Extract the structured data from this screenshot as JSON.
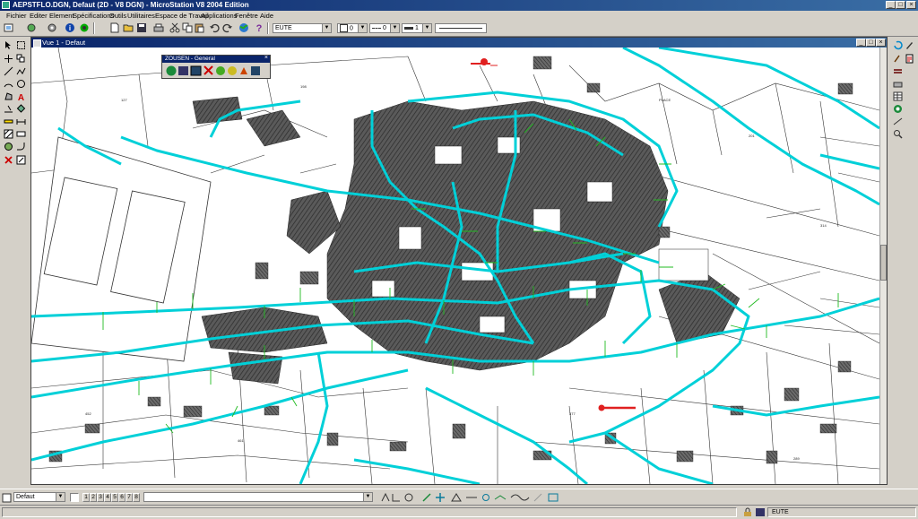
{
  "window": {
    "title": "AEPSTFLO.DGN, Defaut (2D - V8 DGN) - MicroStation V8 2004 Edition",
    "min_label": "_",
    "max_label": "□",
    "close_label": "×"
  },
  "menu": [
    "Fichier",
    "Editer",
    "Element",
    "Spécifications",
    "Outils",
    "Utilitaires",
    "Espace de Travail",
    "Applications",
    "Fenêtre",
    "Aide"
  ],
  "toolbar": {
    "level_combo": "EUTE",
    "color_value": "0",
    "style_value": "0",
    "weight_value": "1"
  },
  "view": {
    "title": "Vue 1 - Defaut"
  },
  "float_palette": {
    "title": "ZOUSEN - General"
  },
  "bottom": {
    "model_combo": "Defaut",
    "view_buttons": [
      "1",
      "2",
      "3",
      "4",
      "5",
      "6",
      "7",
      "8"
    ]
  },
  "status": {
    "level_text": "EUTE"
  },
  "icons": {
    "toolbar": [
      "new-file-icon",
      "open-icon",
      "save-icon",
      "print-icon",
      "cut-icon",
      "copy-icon",
      "paste-icon",
      "undo-icon",
      "redo-icon",
      "globe-icon",
      "help-icon"
    ],
    "left_palette": [
      "select-icon",
      "fence-icon",
      "line-icon",
      "circle-icon",
      "text-icon",
      "cell-icon",
      "measure-icon",
      "delete-icon"
    ]
  },
  "colors": {
    "network": "#00d0d8",
    "branch": "#22bb22",
    "marker": "#e02020",
    "building": "#4a4a4a"
  }
}
